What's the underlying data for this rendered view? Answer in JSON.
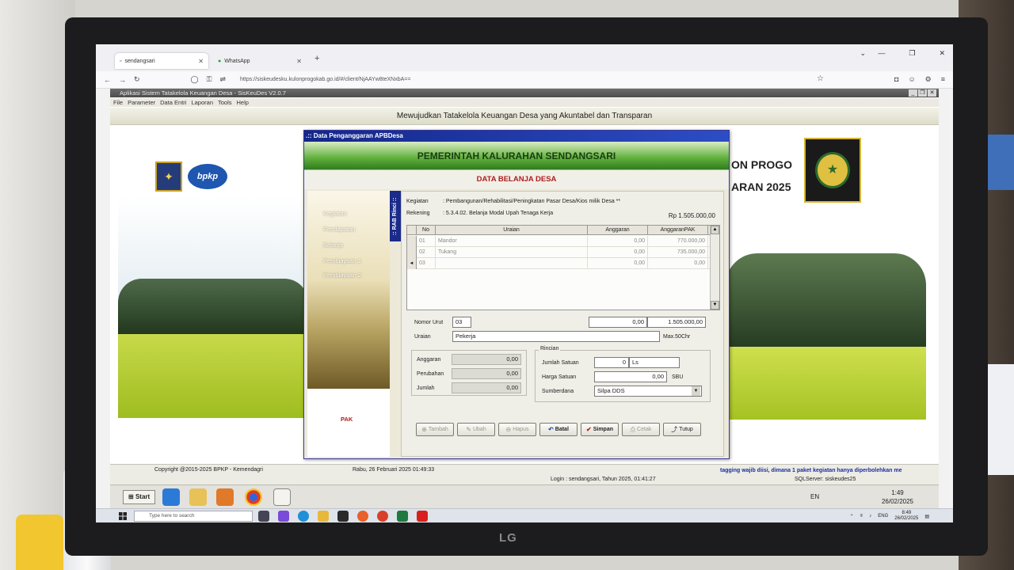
{
  "browser": {
    "tabs": [
      {
        "label": "sendangsari",
        "active": true
      },
      {
        "label": "WhatsApp",
        "active": false
      }
    ],
    "url": "https://siskeudesku.kulonprogokab.go.id/#/client/NjAAYw8teXNxbA=="
  },
  "app": {
    "title": "Aplikasi Sistem Tatakelola Keuangan Desa - SisKeuDes V2.0.7",
    "menu": [
      "File",
      "Parameter",
      "Data Entri",
      "Laporan",
      "Tools",
      "Help"
    ],
    "tagline": "Mewujudkan Tatakelola Keuangan Desa yang Akuntabel dan Transparan",
    "pemda_line1": "ON PROGO",
    "pemda_line2": "ARAN 2025",
    "bpkp_logo_text": "bpkp"
  },
  "dialog": {
    "title": ".:: Data Penganggaran APBDesa",
    "header": "PEMERINTAH KALURAHAN SENDANGSARI",
    "subheader": "DATA BELANJA DESA",
    "side_menu": [
      "Kegiatan",
      "Pendapatan",
      "Belanja",
      "Pembiayaan 1",
      "Pembiayaan 2"
    ],
    "pak_label": "PAK",
    "rab_tab": ":: RAB Rinci ::",
    "kegiatan_label": "Kegiatan",
    "kegiatan_value": ":  Pembangunan/Rehabilitasi/Peningkatan Pasar Desa/Kios milik Desa **",
    "rekening_label": "Rekening",
    "rekening_value": ":  5.3.4.02.  Belanja Modal Upah Tenaga Kerja",
    "rekening_total": "Rp 1.505.000,00",
    "grid": {
      "columns": [
        "No",
        "Uraian",
        "Anggaran",
        "AnggaranPAK"
      ],
      "rows": [
        {
          "no": "01",
          "uraian": "Mandor",
          "anggaran": "0,00",
          "anggaran_pak": "770.000,00"
        },
        {
          "no": "02",
          "uraian": "Tukang",
          "anggaran": "0,00",
          "anggaran_pak": "735.000,00"
        },
        {
          "no": "03",
          "uraian": "",
          "anggaran": "0,00",
          "anggaran_pak": "0,00"
        }
      ],
      "current_row_marker": "◄"
    },
    "nomor_urut_label": "Nomor Urut",
    "nomor_urut_value": "03",
    "total_anggaran": "0,00",
    "total_pak": "1.505.000,00",
    "uraian_label": "Uraian",
    "uraian_value": "Pekerja",
    "max_chr": "Max.50Chr",
    "left_box": {
      "anggaran_label": "Anggaran",
      "anggaran_value": "0,00",
      "perubahan_label": "Perubahan",
      "perubahan_value": "0,00",
      "jumlah_label": "Jumlah",
      "jumlah_value": "0,00"
    },
    "rincian": {
      "legend": "Rincian",
      "jumlah_satuan_label": "Jumlah Satuan",
      "jumlah_satuan_value": "0",
      "satuan_value": "Ls",
      "harga_satuan_label": "Harga Satuan",
      "harga_satuan_value": "0,00",
      "sbu_label": "SBU",
      "sumberdana_label": "Sumberdana",
      "sumberdana_value": "Silpa DDS"
    },
    "buttons": [
      {
        "label": "Tambah",
        "icon": "add-icon",
        "enabled": false,
        "bold": false
      },
      {
        "label": "Ubah",
        "icon": "edit-icon",
        "enabled": false,
        "bold": false
      },
      {
        "label": "Hapus",
        "icon": "delete-icon",
        "enabled": false,
        "bold": false
      },
      {
        "label": "Batal",
        "icon": "cancel-icon",
        "enabled": true,
        "bold": true
      },
      {
        "label": "Simpan",
        "icon": "check-icon",
        "enabled": true,
        "bold": true
      },
      {
        "label": "Cetak",
        "icon": "print-icon",
        "enabled": false,
        "bold": false
      },
      {
        "label": "Tutup",
        "icon": "close-icon",
        "enabled": true,
        "bold": false
      }
    ]
  },
  "status": {
    "copyright": "Copyright @2015-2025 BPKP - Kemendagri",
    "date": "Rabu, 26 Februari 2025  01:49:33",
    "marquee": "tagging wajib diisi, dimana 1 paket kegiatan hanya diperbolehkan me",
    "login": "Login : sendangsari,  Tahun 2025, 01:41:27",
    "sqlserver": "SQLServer: siskeudes25"
  },
  "xp_taskbar": {
    "start": "Start",
    "lang": "EN",
    "time": "1:49",
    "date": "26/02/2025"
  },
  "win_taskbar": {
    "search_placeholder": "Type here to search",
    "lang": "ENG",
    "time": "8:49",
    "date": "26/02/2025"
  },
  "colors": {
    "dialog_title": "#14278a",
    "header_green": "#2f7b1e",
    "subheader_red": "#b01c1c",
    "marquee_blue": "#1a2fa0"
  }
}
